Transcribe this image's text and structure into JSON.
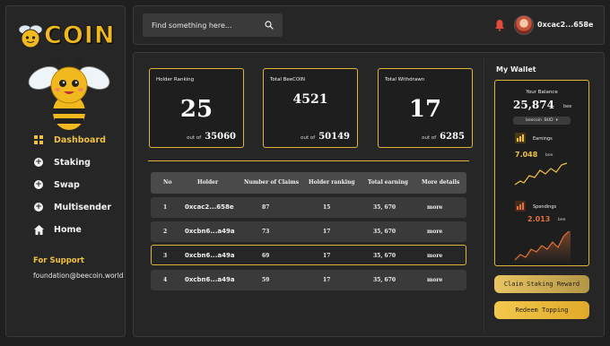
{
  "brand": {
    "logo_text": "COIN"
  },
  "sidebar": {
    "items": [
      {
        "label": "Dashboard",
        "icon": "grid-icon"
      },
      {
        "label": "Staking",
        "icon": "plus-circle-icon"
      },
      {
        "label": "Swap",
        "icon": "plus-circle-icon"
      },
      {
        "label": "Multisender",
        "icon": "plus-circle-icon"
      },
      {
        "label": "Home",
        "icon": "home-icon"
      }
    ],
    "support_title": "For Support",
    "support_email": "foundation@beecoin.world"
  },
  "topbar": {
    "search_placeholder": "Find something here...",
    "user_name": "0xcac2...658e"
  },
  "stats": [
    {
      "label": "Holder Ranking",
      "value": "25",
      "out_label": "out of",
      "total": "35060"
    },
    {
      "label": "Total BeeCOIN",
      "value": "4521",
      "out_label": "out of",
      "total": "50149"
    },
    {
      "label": "Total Withdrawn",
      "value": "17",
      "out_label": "out of",
      "total": "6285"
    }
  ],
  "table": {
    "headers": [
      "No",
      "Holder",
      "Number of Claims",
      "Holder ranking",
      "Total earning",
      "More details"
    ],
    "rows": [
      {
        "no": "1",
        "holder": "0xcac2...658e",
        "claims": "87",
        "ranking": "15",
        "earning": "35, 670",
        "more": "more"
      },
      {
        "no": "2",
        "holder": "0xcbn6...a49a",
        "claims": "73",
        "ranking": "17",
        "earning": "35, 670",
        "more": "more"
      },
      {
        "no": "3",
        "holder": "0xcbn6...a49a",
        "claims": "69",
        "ranking": "17",
        "earning": "35, 670",
        "more": "more"
      },
      {
        "no": "4",
        "holder": "0xcbn6...a49a",
        "claims": "59",
        "ranking": "17",
        "earning": "35, 670",
        "more": "more"
      }
    ]
  },
  "wallet": {
    "title": "My Wallet",
    "balance_label": "Your Balance",
    "balance": "25,874",
    "balance_unit": "bee",
    "currency_left": "beecoin",
    "currency_right": "BUD",
    "earnings_label": "Earnings",
    "earnings_value": "7.048",
    "earnings_unit": "bee",
    "spendings_label": "Spendings",
    "spendings_value": "2.013",
    "spendings_unit": "bee",
    "claim_label": "Claim Staking Reward",
    "redeem_label": "Redeem Topping"
  },
  "colors": {
    "accent": "#e0b43a",
    "earn": "#f0c243",
    "spend": "#e0733a"
  }
}
